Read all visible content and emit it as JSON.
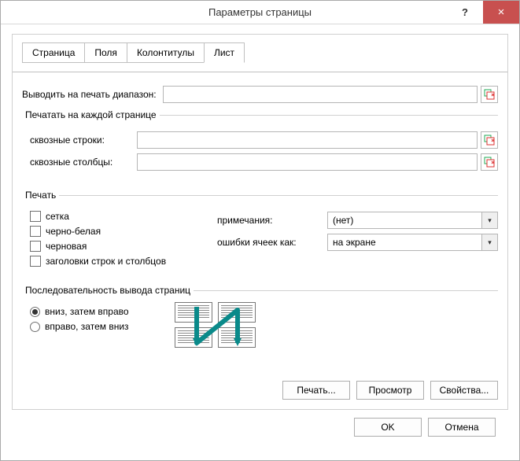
{
  "window": {
    "title": "Параметры страницы",
    "help_symbol": "?",
    "close_symbol": "×"
  },
  "tabs": {
    "page": "Страница",
    "fields": "Поля",
    "headers": "Колонтитулы",
    "sheet": "Лист"
  },
  "active_tab": "sheet",
  "print_area": {
    "label": "Выводить на печать диапазон:",
    "value": ""
  },
  "titles_group": {
    "legend": "Печатать на каждой странице",
    "rows_label": "сквозные строки:",
    "rows_value": "",
    "cols_label": "сквозные столбцы:",
    "cols_value": ""
  },
  "print_group": {
    "legend": "Печать",
    "grid": "сетка",
    "bw": "черно-белая",
    "draft": "черновая",
    "headings": "заголовки строк и столбцов",
    "comments_label": "примечания:",
    "comments_value": "(нет)",
    "errors_label": "ошибки ячеек как:",
    "errors_value": "на экране"
  },
  "order_group": {
    "legend": "Последовательность вывода страниц",
    "down_right": "вниз, затем вправо",
    "right_down": "вправо, затем вниз",
    "selected": "down_right"
  },
  "buttons": {
    "print": "Печать...",
    "preview": "Просмотр",
    "props": "Свойства...",
    "ok": "OK",
    "cancel": "Отмена"
  }
}
